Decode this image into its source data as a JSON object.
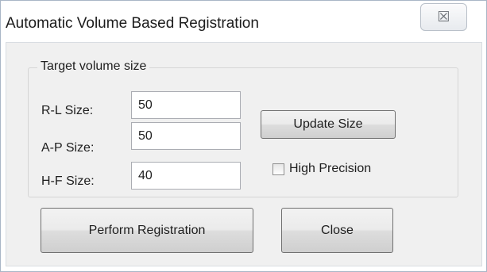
{
  "window": {
    "title": "Automatic Volume Based Registration",
    "close_glyph": "☒"
  },
  "target_volume": {
    "group_label": "Target volume size",
    "rl": {
      "label": "R-L Size:",
      "value": "50"
    },
    "ap": {
      "label": "A-P Size:",
      "value": "50"
    },
    "hf": {
      "label": "H-F  Size:",
      "value": "40"
    }
  },
  "buttons": {
    "update_size": "Update Size",
    "perform_registration": "Perform Registration",
    "close": "Close"
  },
  "high_precision": {
    "label": "High Precision",
    "checked": false
  }
}
